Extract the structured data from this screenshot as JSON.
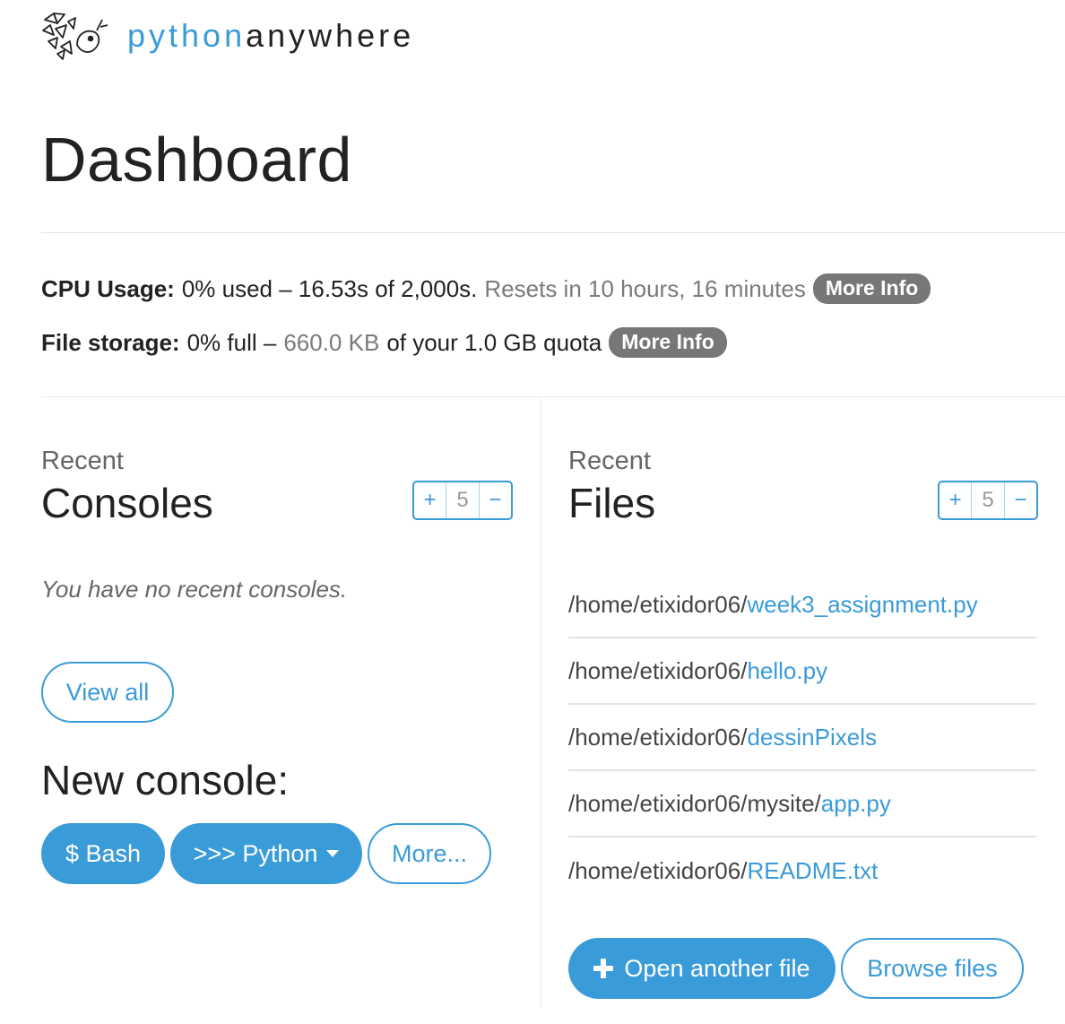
{
  "brand": {
    "part1": "python",
    "part2": "anywhere"
  },
  "page_title": "Dashboard",
  "cpu": {
    "label": "CPU Usage:",
    "used": "0% used – 16.53s of 2,000s.",
    "reset": "Resets in 10 hours, 16 minutes",
    "more_info": "More Info"
  },
  "storage": {
    "label": "File storage:",
    "full": "0% full –",
    "amount": "660.0 KB",
    "quota": "of your 1.0 GB quota",
    "more_info": "More Info"
  },
  "consoles": {
    "kicker": "Recent",
    "heading": "Consoles",
    "stepper": {
      "plus": "+",
      "count": "5",
      "minus": "−"
    },
    "empty_note": "You have no recent consoles.",
    "view_all": "View all",
    "new_console_title": "New console:",
    "buttons": {
      "bash": "$ Bash",
      "python": ">>> Python",
      "more": "More..."
    }
  },
  "files": {
    "kicker": "Recent",
    "heading": "Files",
    "stepper": {
      "plus": "+",
      "count": "5",
      "minus": "−"
    },
    "items": [
      {
        "path": "/home/etixidor06/",
        "name": "week3_assignment.py"
      },
      {
        "path": "/home/etixidor06/",
        "name": "hello.py"
      },
      {
        "path": "/home/etixidor06/",
        "name": "dessinPixels"
      },
      {
        "path": "/home/etixidor06/mysite/",
        "name": "app.py"
      },
      {
        "path": "/home/etixidor06/",
        "name": "README.txt"
      }
    ],
    "open_another": "Open another file",
    "browse": "Browse files"
  },
  "colors": {
    "accent": "#3a9bd9",
    "pill": "#777777",
    "text": "#222222",
    "muted": "#7a7a7a"
  }
}
